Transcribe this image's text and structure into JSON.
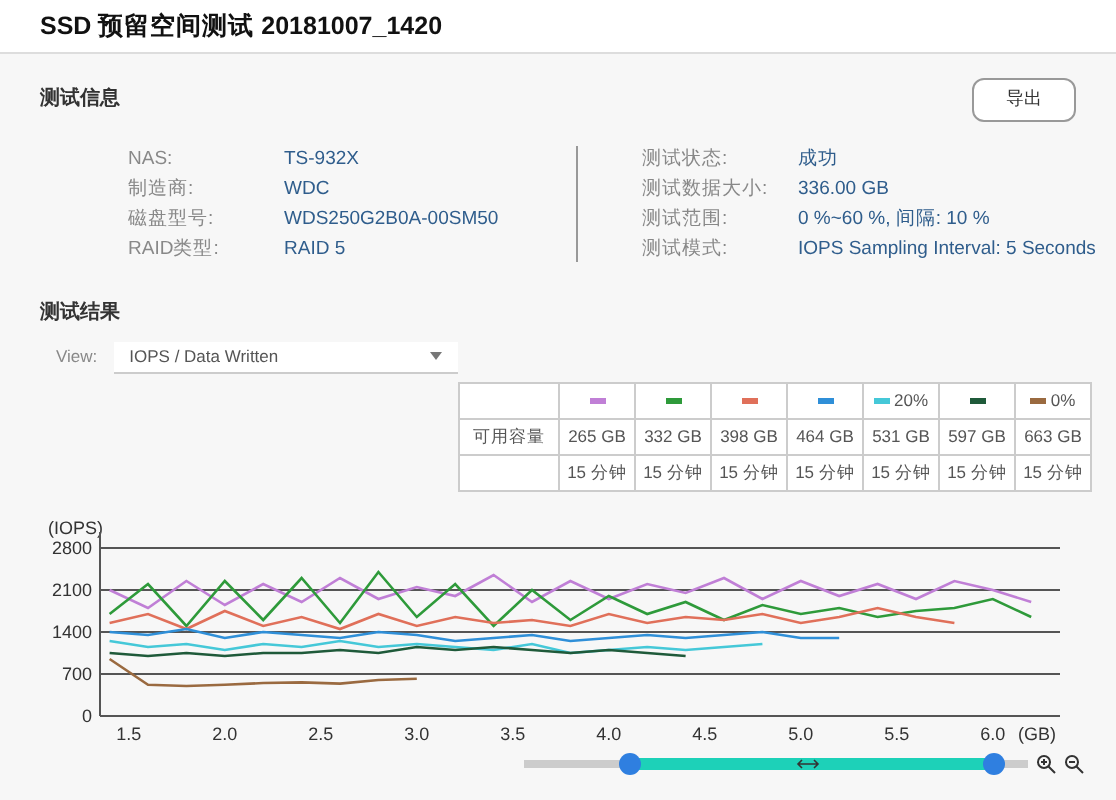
{
  "window": {
    "title": "SSD 预留空间测试 20181007_1420"
  },
  "test_info": {
    "heading": "测试信息",
    "export_button": "导出",
    "left": [
      {
        "label": "NAS:",
        "value": "TS-932X"
      },
      {
        "label": "制造商:",
        "value": "WDC"
      },
      {
        "label": "磁盘型号:",
        "value": "WDS250G2B0A-00SM50"
      },
      {
        "label": "RAID类型:",
        "value": "RAID 5"
      }
    ],
    "right": [
      {
        "label": "测试状态:",
        "value": "成功"
      },
      {
        "label": "测试数据大小:",
        "value": "336.00 GB"
      },
      {
        "label": "测试范围:",
        "value": "0 %~60 %, 间隔: 10 %"
      },
      {
        "label": "测试模式:",
        "value": "IOPS Sampling Interval: 5 Seconds"
      }
    ]
  },
  "test_results": {
    "heading": "测试结果",
    "view_label": "View:",
    "view_select": "IOPS / Data Written",
    "table": {
      "header": [
        {
          "color": "#c07fd6"
        },
        {
          "color": "#2e9a3a"
        },
        {
          "color": "#e0705a"
        },
        {
          "color": "#2f8fd8"
        },
        {
          "label": "20%",
          "color": "#45c8d8"
        },
        {
          "color": "#1f5a3a"
        },
        {
          "label": "0%",
          "color": "#9a6a40"
        }
      ],
      "rows": [
        {
          "label": "可用容量",
          "cells": [
            "265 GB",
            "332 GB",
            "398 GB",
            "464 GB",
            "531 GB",
            "597 GB",
            "663 GB"
          ]
        },
        {
          "cells": [
            "15 分钟",
            "15 分钟",
            "15 分钟",
            "15 分钟",
            "15 分钟",
            "15 分钟",
            "15 分钟"
          ]
        }
      ]
    },
    "chart_data": {
      "type": "line",
      "xlabel": "(GB)",
      "ylabel": "(IOPS)",
      "xlim": [
        1.35,
        6.35
      ],
      "ylim": [
        0,
        3000
      ],
      "grid": true,
      "xticks": [
        1.5,
        {
          "value": 2,
          "label": "2.0"
        },
        2.5,
        {
          "value": 3,
          "label": "3.0"
        },
        3.5,
        {
          "value": 4,
          "label": "4.0"
        },
        4.5,
        {
          "value": 5,
          "label": "5.0"
        },
        5.5,
        {
          "value": 6,
          "label": "6.0"
        }
      ],
      "yticks": [
        0,
        700,
        1400,
        2100,
        2800
      ],
      "x": [
        1.4,
        1.6,
        1.8,
        2.0,
        2.2,
        2.4,
        2.6,
        2.8,
        3.0,
        3.2,
        3.4,
        3.6,
        3.8,
        4.0,
        4.2,
        4.4,
        4.6,
        4.8,
        5.0,
        5.2,
        5.4,
        5.6,
        5.8,
        6.0,
        6.2
      ],
      "series": [
        {
          "color": "#c07fd6",
          "values": [
            2100,
            1800,
            2250,
            1850,
            2200,
            1900,
            2300,
            1950,
            2150,
            2000,
            2350,
            1900,
            2250,
            1950,
            2200,
            2050,
            2300,
            1950,
            2250,
            2000,
            2200,
            1950,
            2250,
            2100,
            1900
          ]
        },
        {
          "color": "#2e9a3a",
          "values": [
            1700,
            2200,
            1500,
            2250,
            1600,
            2300,
            1550,
            2400,
            1650,
            2200,
            1500,
            2100,
            1600,
            2000,
            1700,
            1900,
            1600,
            1850,
            1700,
            1800,
            1650,
            1750,
            1800,
            1950,
            1650
          ]
        },
        {
          "color": "#e0705a",
          "values": [
            1550,
            1700,
            1450,
            1750,
            1500,
            1650,
            1450,
            1700,
            1500,
            1650,
            1550,
            1600,
            1500,
            1700,
            1550,
            1650,
            1600,
            1700,
            1550,
            1650,
            1800,
            1650,
            1550,
            null,
            null
          ]
        },
        {
          "color": "#2f8fd8",
          "values": [
            1400,
            1350,
            1450,
            1300,
            1400,
            1350,
            1300,
            1400,
            1350,
            1250,
            1300,
            1350,
            1250,
            1300,
            1350,
            1300,
            1350,
            1400,
            1300,
            1300,
            null,
            null,
            null,
            null,
            null
          ]
        },
        {
          "color": "#45c8d8",
          "values": [
            1250,
            1150,
            1200,
            1100,
            1200,
            1150,
            1250,
            1150,
            1200,
            1150,
            1100,
            1200,
            1050,
            1100,
            1150,
            1100,
            1150,
            1200,
            null,
            null,
            null,
            null,
            null,
            null,
            null
          ]
        },
        {
          "color": "#1f5a3a",
          "values": [
            1050,
            1000,
            1050,
            1000,
            1050,
            1050,
            1100,
            1050,
            1150,
            1100,
            1150,
            1100,
            1050,
            1100,
            1050,
            1000,
            null,
            null,
            null,
            null,
            null,
            null,
            null,
            null,
            null
          ]
        },
        {
          "color": "#9a6a40",
          "values": [
            950,
            520,
            500,
            520,
            550,
            560,
            540,
            600,
            620,
            null,
            null,
            null,
            null,
            null,
            null,
            null,
            null,
            null,
            null,
            null,
            null,
            null,
            null,
            null,
            null
          ]
        }
      ]
    }
  }
}
